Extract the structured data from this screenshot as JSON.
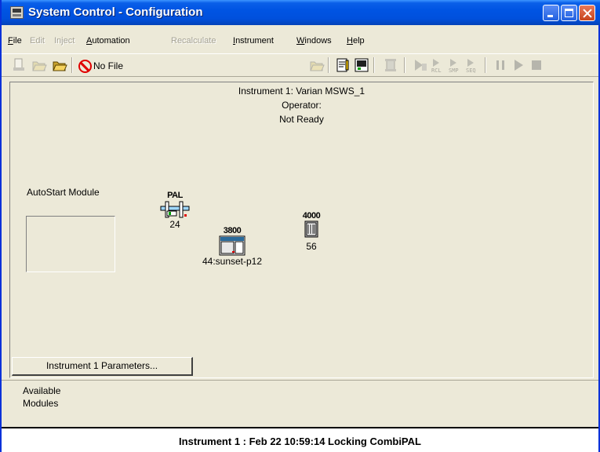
{
  "window": {
    "title": "System Control - Configuration",
    "titlebar_color": "#0054e3"
  },
  "menu": {
    "items": [
      {
        "label": "File",
        "enabled": true
      },
      {
        "label": "Edit",
        "enabled": false
      },
      {
        "label": "Inject",
        "enabled": false
      },
      {
        "label": "Automation",
        "enabled": true
      },
      {
        "label": "Recalculate",
        "enabled": false
      },
      {
        "label": "Instrument",
        "enabled": true
      },
      {
        "label": "Windows",
        "enabled": true
      },
      {
        "label": "Help",
        "enabled": true
      }
    ]
  },
  "toolbar": {
    "method_label": "No File"
  },
  "instrument": {
    "title": "Instrument 1: Varian MSWS_1",
    "operator": "Operator:",
    "status": "Not Ready"
  },
  "autostart": {
    "label": "AutoStart Module"
  },
  "modules": [
    {
      "model": "PAL",
      "label": "24",
      "icon": "pal-autosampler-icon"
    },
    {
      "model": "3800",
      "label": "44:sunset-p12",
      "icon": "gc-3800-icon"
    },
    {
      "model": "4000",
      "label": "56",
      "icon": "ms-4000-icon"
    }
  ],
  "parameters_button": {
    "label": "Instrument 1 Parameters..."
  },
  "available_modules": {
    "label": "Available\nModules"
  },
  "statusbar": {
    "text": "Instrument 1 : Feb 22 10:59:14  Locking CombiPAL"
  }
}
